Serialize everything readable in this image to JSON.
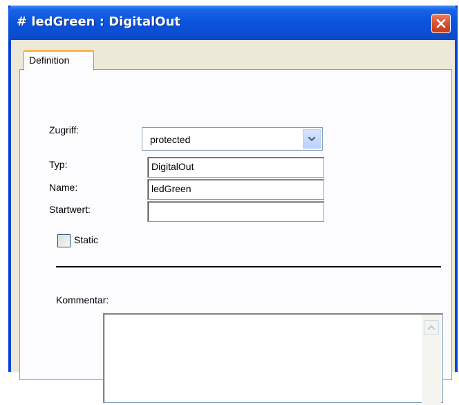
{
  "window": {
    "title": "# ledGreen : DigitalOut"
  },
  "tabs": [
    {
      "label": "Definition",
      "active": true
    }
  ],
  "form": {
    "access_label": "Zugriff:",
    "access_value": "protected",
    "type_label": "Typ:",
    "type_value": "DigitalOut",
    "name_label": "Name:",
    "name_value": "ledGreen",
    "start_label": "Startwert:",
    "start_value": "",
    "static_label": "Static",
    "static_checked": false,
    "comment_label": "Kommentar:",
    "comment_value": ""
  },
  "icons": {
    "close": "close-icon",
    "dropdown": "chevron-down-icon",
    "scroll_up": "scroll-up-arrow-icon"
  },
  "colors": {
    "titlebar": "#0b54dc",
    "close_button": "#d9532f",
    "active_tab_accent": "#f7b64a",
    "dialog_background": "#ece9d8"
  }
}
